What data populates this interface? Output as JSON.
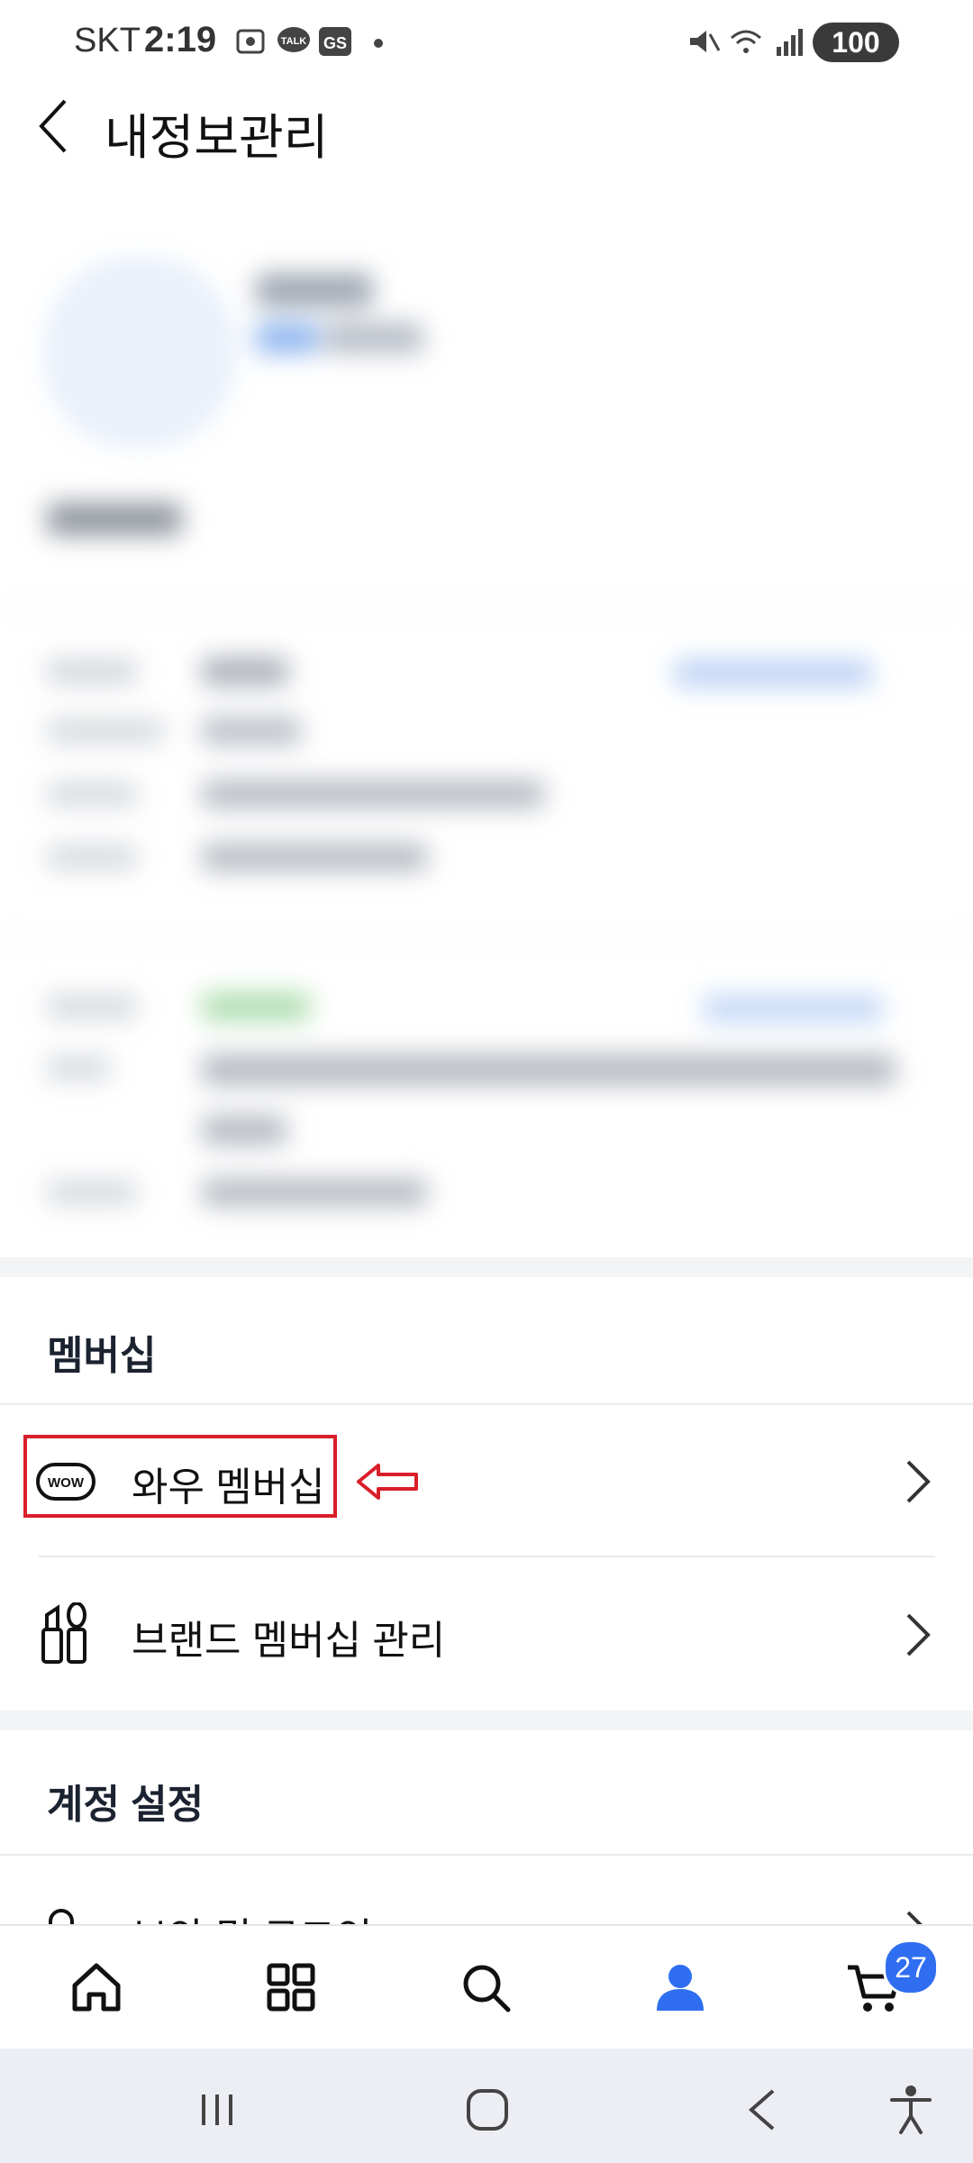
{
  "status_bar": {
    "carrier": "SKT",
    "time": "2:19",
    "notif_icons": [
      "screenshot-icon",
      "talk-icon",
      "gs-icon",
      "dot-icon"
    ],
    "sys_icons": [
      "mute-icon",
      "wifi-icon",
      "signal-icon"
    ],
    "battery": "100"
  },
  "header": {
    "back_icon": "back-chevron-icon",
    "title": "내정보관리"
  },
  "membership": {
    "section_title": "멤버십",
    "items": [
      {
        "label": "와우 멤버십",
        "icon": "wow-icon"
      },
      {
        "label": "브랜드 멤버십 관리",
        "icon": "brand-cosmetics-icon"
      }
    ]
  },
  "account": {
    "section_title": "계정 설정",
    "items": [
      {
        "label": "보안 및 로그인",
        "icon": "lock-icon"
      }
    ]
  },
  "bottom_nav": {
    "items": [
      "home-icon",
      "category-icon",
      "search-icon",
      "my-account-icon",
      "cart-icon"
    ],
    "cart_badge": "27",
    "active_color": "#2f6ef0"
  },
  "system_nav": [
    "recent-apps-icon",
    "home-button-icon",
    "back-button-icon",
    "accessibility-icon"
  ]
}
